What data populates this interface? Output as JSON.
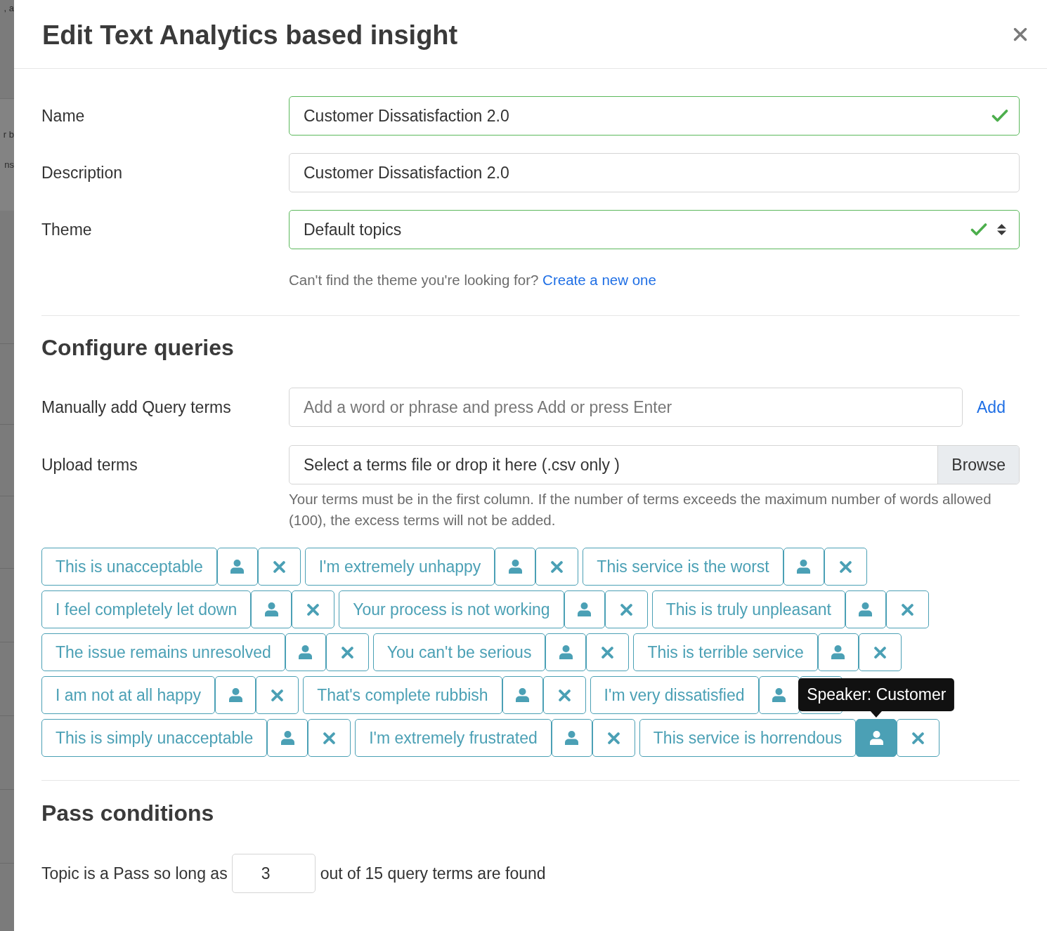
{
  "backdrop": {
    "fragments": [
      ", a",
      "r b",
      "ns"
    ]
  },
  "dialog": {
    "title": "Edit Text Analytics based insight"
  },
  "fields": [
    {
      "kind": "text",
      "label": "Name",
      "value": "Customer Dissatisfaction 2.0",
      "valid": true
    },
    {
      "kind": "text",
      "label": "Description",
      "value": "Customer Dissatisfaction 2.0",
      "valid": false
    },
    {
      "kind": "select",
      "label": "Theme",
      "value": "Default topics",
      "valid": true,
      "help": "Can't find the theme you're looking for?",
      "help_link": "Create a new one"
    }
  ],
  "configure_queries": {
    "heading": "Configure queries",
    "manual": {
      "label": "Manually add Query terms",
      "placeholder": "Add a word or phrase and press Add or press Enter",
      "button": "Add"
    },
    "upload": {
      "label": "Upload terms",
      "prompt": "Select a terms file or drop it here (.csv only )",
      "button": "Browse",
      "help": "Your terms must be in the first column. If the number of terms exceeds the maximum number of words allowed (100), the excess terms will not be added."
    },
    "terms": [
      {
        "text": "This is unacceptable",
        "speaker_active": false
      },
      {
        "text": "I'm extremely unhappy",
        "speaker_active": false
      },
      {
        "text": "This service is the worst",
        "speaker_active": false
      },
      {
        "text": "I feel completely let down",
        "speaker_active": false
      },
      {
        "text": "Your process is not working",
        "speaker_active": false
      },
      {
        "text": "This is truly unpleasant",
        "speaker_active": false
      },
      {
        "text": "The issue remains unresolved",
        "speaker_active": false
      },
      {
        "text": "You can't be serious",
        "speaker_active": false
      },
      {
        "text": "This is terrible service",
        "speaker_active": false
      },
      {
        "text": "I am not at all happy",
        "speaker_active": false
      },
      {
        "text": "That's complete rubbish",
        "speaker_active": false
      },
      {
        "text": "I'm very dissatisfied",
        "speaker_active": false
      },
      {
        "text": "This is simply unacceptable",
        "speaker_active": false
      },
      {
        "text": "I'm extremely frustrated",
        "speaker_active": false
      },
      {
        "text": "This service is horrendous",
        "speaker_active": true,
        "tooltip": "Speaker: Customer"
      }
    ]
  },
  "pass_conditions": {
    "heading": "Pass conditions",
    "prefix": "Topic is a Pass so long as",
    "value": "3",
    "suffix": "out of 15 query terms are found"
  }
}
